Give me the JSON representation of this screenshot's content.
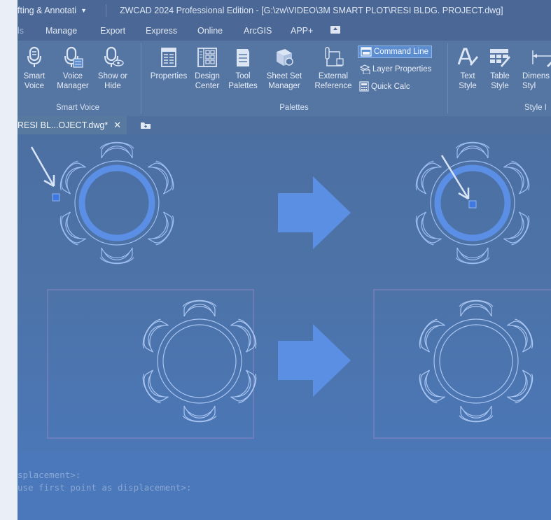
{
  "titlebar": {
    "workspace": "fting & Annotati",
    "workspace_arrow": "▼",
    "title": "ZWCAD 2024 Professional Edition - [G:\\zw\\VIDEO\\3M SMART PLOT\\RESI BLDG. PROJECT.dwg]"
  },
  "ribbon_tabs": [
    "ls",
    "Manage",
    "Export",
    "Express",
    "Online",
    "ArcGIS",
    "APP+"
  ],
  "ribbon": {
    "smart_voice": {
      "buttons": [
        {
          "label": "Smart\nVoice",
          "icon": "microphone-icon"
        },
        {
          "label": "Voice\nManager",
          "icon": "voice-manager-icon"
        },
        {
          "label": "Show or\nHide",
          "icon": "show-hide-icon"
        }
      ],
      "panel_label": "Smart Voice"
    },
    "palettes": {
      "buttons": [
        {
          "label": "Properties",
          "icon": "properties-icon"
        },
        {
          "label": "Design\nCenter",
          "icon": "design-center-icon"
        },
        {
          "label": "Tool\nPalettes",
          "icon": "tool-palettes-icon"
        },
        {
          "label": "Sheet Set\nManager",
          "icon": "sheet-set-icon"
        },
        {
          "label": "External\nReference",
          "icon": "external-reference-icon"
        }
      ],
      "small_buttons": [
        {
          "label": "Command Line",
          "icon": "command-line-icon"
        },
        {
          "label": "Layer Properties",
          "icon": "layer-properties-icon"
        },
        {
          "label": "Quick Calc",
          "icon": "calculator-icon"
        }
      ],
      "panel_label": "Palettes"
    },
    "style": {
      "buttons": [
        {
          "label": "Text\nStyle",
          "icon": "text-style-icon"
        },
        {
          "label": "Table\nStyle",
          "icon": "table-style-icon"
        },
        {
          "label": "Dimens\nStyl",
          "icon": "dimension-style-icon"
        }
      ],
      "panel_label": "Style I"
    }
  },
  "doc_tab": {
    "label": "RESI BL...OJECT.dwg*",
    "close": "✕"
  },
  "command": {
    "lines": [
      "splacement>:",
      "use first point as displacement>:"
    ]
  },
  "colors": {
    "ribbon": "#5575a3",
    "titlebar": "#4a6795",
    "accent": "#5c8dd0",
    "selected_drawing": "#5b8fe6",
    "drawing": "#a8c4f0"
  }
}
